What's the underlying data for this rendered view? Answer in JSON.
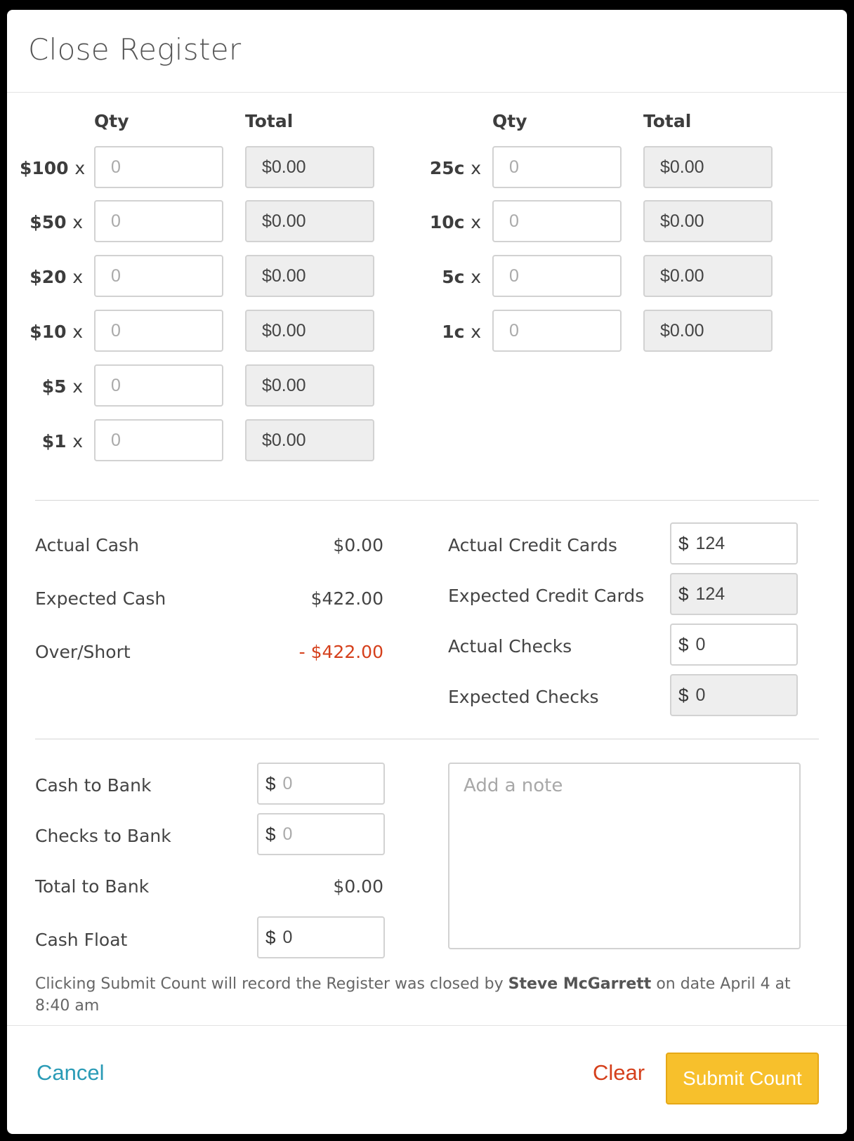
{
  "title": "Close Register",
  "columns": {
    "qty": "Qty",
    "total": "Total"
  },
  "bills": [
    {
      "label": "$100",
      "x": "x",
      "qty_placeholder": "0",
      "total": "$0.00"
    },
    {
      "label": "$50",
      "x": "x",
      "qty_placeholder": "0",
      "total": "$0.00"
    },
    {
      "label": "$20",
      "x": "x",
      "qty_placeholder": "0",
      "total": "$0.00"
    },
    {
      "label": "$10",
      "x": "x",
      "qty_placeholder": "0",
      "total": "$0.00"
    },
    {
      "label": "$5",
      "x": "x",
      "qty_placeholder": "0",
      "total": "$0.00"
    },
    {
      "label": "$1",
      "x": "x",
      "qty_placeholder": "0",
      "total": "$0.00"
    }
  ],
  "coins": [
    {
      "label": "25c",
      "x": "x",
      "qty_placeholder": "0",
      "total": "$0.00"
    },
    {
      "label": "10c",
      "x": "x",
      "qty_placeholder": "0",
      "total": "$0.00"
    },
    {
      "label": "5c",
      "x": "x",
      "qty_placeholder": "0",
      "total": "$0.00"
    },
    {
      "label": "1c",
      "x": "x",
      "qty_placeholder": "0",
      "total": "$0.00"
    }
  ],
  "summary": {
    "actual_cash": {
      "label": "Actual Cash",
      "value": "$0.00"
    },
    "expected_cash": {
      "label": "Expected Cash",
      "value": "$422.00"
    },
    "over_short": {
      "label": "Over/Short",
      "value": "- $422.00"
    }
  },
  "payments": {
    "currency": "$",
    "actual_credit": {
      "label": "Actual Credit Cards",
      "value": "124"
    },
    "expected_credit": {
      "label": "Expected Credit Cards",
      "value": "124"
    },
    "actual_checks": {
      "label": "Actual Checks",
      "value": "0"
    },
    "expected_checks": {
      "label": "Expected Checks",
      "value": "0"
    }
  },
  "bank": {
    "cash_to_bank": {
      "label": "Cash to Bank",
      "placeholder": "0"
    },
    "checks_to_bank": {
      "label": "Checks to Bank",
      "placeholder": "0"
    },
    "total_to_bank": {
      "label": "Total to Bank",
      "value": "$0.00"
    },
    "cash_float": {
      "label": "Cash Float",
      "value": "0"
    }
  },
  "note_placeholder": "Add a note",
  "info": {
    "prefix": "Clicking Submit Count will record the Register was closed by",
    "user": "Steve McGarrett",
    "suffix": "on date April 4 at 8:40 am"
  },
  "actions": {
    "cancel": "Cancel",
    "clear": "Clear",
    "submit": "Submit Count"
  },
  "colors": {
    "accent_link": "#2a9bb6",
    "danger": "#d5401c",
    "submit_bg": "#f7c02c"
  }
}
